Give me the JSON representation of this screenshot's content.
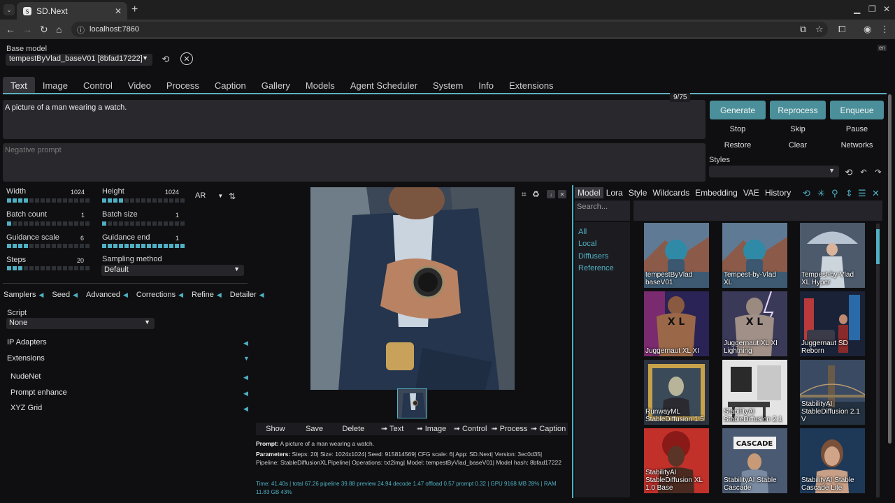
{
  "browser": {
    "tab_title": "SD.Next",
    "url": "localhost:7860"
  },
  "header": {
    "base_model_label": "Base model",
    "base_model_value": "tempestByVlad_baseV01 [8bfad17222]",
    "lang": "en"
  },
  "tabs": [
    "Text",
    "Image",
    "Control",
    "Video",
    "Process",
    "Caption",
    "Gallery",
    "Models",
    "Agent Scheduler",
    "System",
    "Info",
    "Extensions"
  ],
  "prompt": {
    "text": "A picture of a man wearing a watch.",
    "counter": "9/75",
    "negative_placeholder": "Negative prompt"
  },
  "actions": {
    "generate": "Generate",
    "reprocess": "Reprocess",
    "enqueue": "Enqueue",
    "stop": "Stop",
    "skip": "Skip",
    "pause": "Pause",
    "restore": "Restore",
    "clear": "Clear",
    "networks": "Networks",
    "styles_label": "Styles"
  },
  "params": {
    "width_label": "Width",
    "width": "1024",
    "width_level": 0.25,
    "height_label": "Height",
    "height": "1024",
    "height_level": 0.25,
    "batch_count_label": "Batch count",
    "batch_count": "1",
    "batch_count_level": 0.07,
    "batch_size_label": "Batch size",
    "batch_size": "1",
    "batch_size_level": 0.07,
    "guidance_scale_label": "Guidance scale",
    "guidance_scale": "6",
    "guidance_scale_level": 0.25,
    "guidance_end_label": "Guidance end",
    "guidance_end": "1",
    "guidance_end_level": 1.0,
    "steps_label": "Steps",
    "steps": "20",
    "steps_level": 0.2,
    "ar_label": "AR",
    "sampling_label": "Sampling method",
    "sampling_value": "Default"
  },
  "accordions": [
    "Samplers",
    "Seed",
    "Advanced",
    "Corrections",
    "Refine",
    "Detailer"
  ],
  "script": {
    "label": "Script",
    "value": "None"
  },
  "sections": {
    "ip_adapters": "IP Adapters",
    "extensions": "Extensions",
    "nudenet": "NudeNet",
    "prompt_enhance": "Prompt enhance",
    "xyz_grid": "XYZ Grid"
  },
  "gallery_buttons": [
    "Show",
    "Save",
    "Delete",
    "➟ Text",
    "➟ Image",
    "➟ Control",
    "➟ Process",
    "➟ Caption"
  ],
  "info": {
    "prompt_label": "Prompt:",
    "prompt_value": " A picture of a man wearing a watch.",
    "params_label": "Parameters:",
    "params_value": " Steps: 20| Size: 1024x1024| Seed: 915814569| CFG scale: 6| App: SD.Next| Version: 3ec0d35| Pipeline: StableDiffusionXLPipeline| Operations: txt2img| Model: tempestByVlad_baseV01| Model hash: 8bfad17222",
    "timing": "Time: 41.40s | total 67.26 pipeline 39.88 preview 24.94 decode 1.47 offload 0.57 prompt 0.32 | GPU 9168 MB 28% | RAM 11.83 GB 43%"
  },
  "networks": {
    "tabs": [
      "Model",
      "Lora",
      "Style",
      "Wildcards",
      "Embedding",
      "VAE",
      "History"
    ],
    "search_placeholder": "Search...",
    "filters": [
      "All",
      "Local",
      "Diffusers",
      "Reference"
    ],
    "cards": [
      "tempestByVlad baseV01",
      "Tempest-by-Vlad XL",
      "Tempest-by-Vlad XL Hyper",
      "Juggernaut XL XI",
      "Juggernaut XL XI Lightning",
      "Juggernaut SD Reborn",
      "RunwayML StableDiffusion 1.5",
      "StabilityAI StableDiffusion 2.1",
      "StabilityAI StableDiffusion 2.1 V",
      "StabilityAI StableDiffusion XL 1.0 Base",
      "StabilityAI Stable Cascade",
      "StabilityAI Stable Cascade Lite"
    ],
    "cascade_sign": "CASCADE",
    "colors": {
      "accent": "#4fb0c3",
      "button": "#4a8f99"
    }
  }
}
